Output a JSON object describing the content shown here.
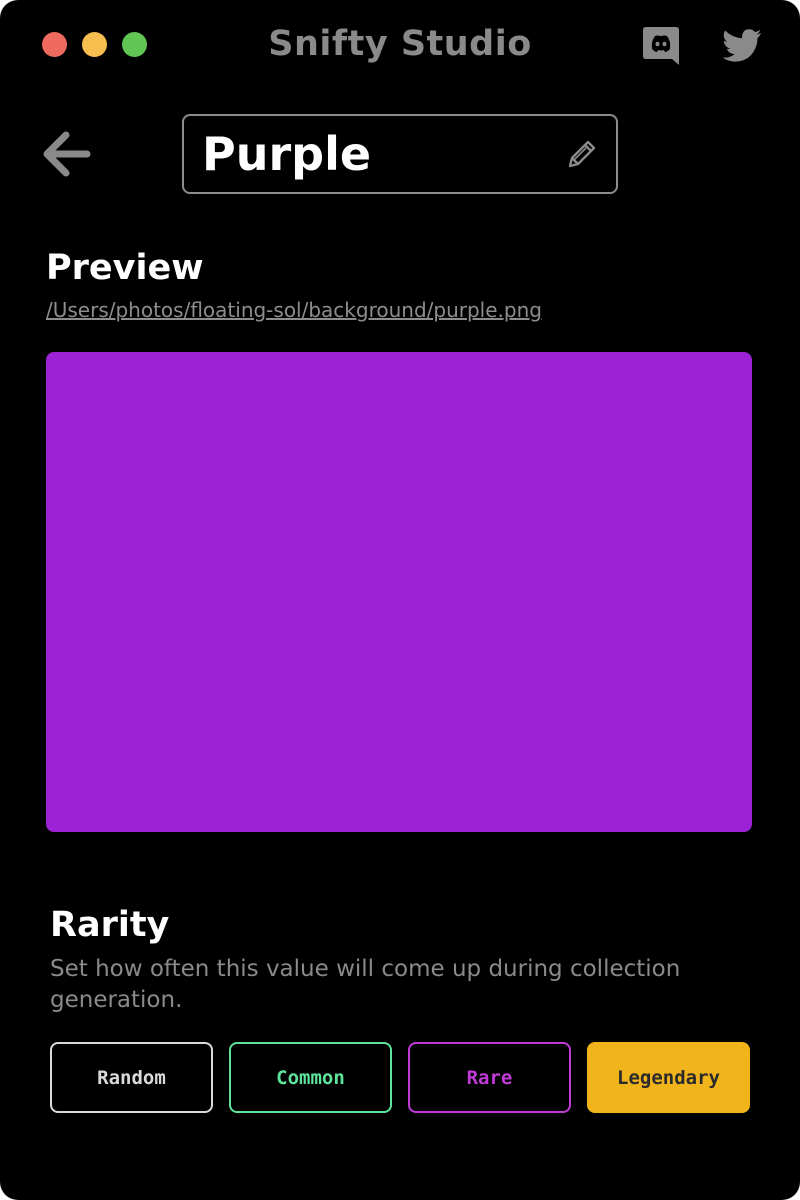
{
  "window": {
    "title": "Snifty Studio",
    "traffic_colors": [
      "#ee6a5f",
      "#f5be4f",
      "#61c554"
    ]
  },
  "header": {
    "social_icons": [
      "discord-icon",
      "twitter-icon"
    ],
    "back_icon": "arrow-left-icon",
    "name_field": {
      "value": "Purple",
      "edit_icon": "pencil-icon"
    }
  },
  "preview": {
    "title": "Preview",
    "file_path": "/Users/photos/floating-sol/background/purple.png",
    "swatch_color": "#9b22d5"
  },
  "rarity": {
    "title": "Rarity",
    "description": "Set how often this value will come up during collection generation.",
    "options": [
      {
        "label": "Random",
        "color": "#d9d9d9",
        "selected": false
      },
      {
        "label": "Common",
        "color": "#5ee39b",
        "selected": false
      },
      {
        "label": "Rare",
        "color": "#c13ad8",
        "selected": false
      },
      {
        "label": "Legendary",
        "color": "#f2b41b",
        "selected": true
      }
    ]
  }
}
